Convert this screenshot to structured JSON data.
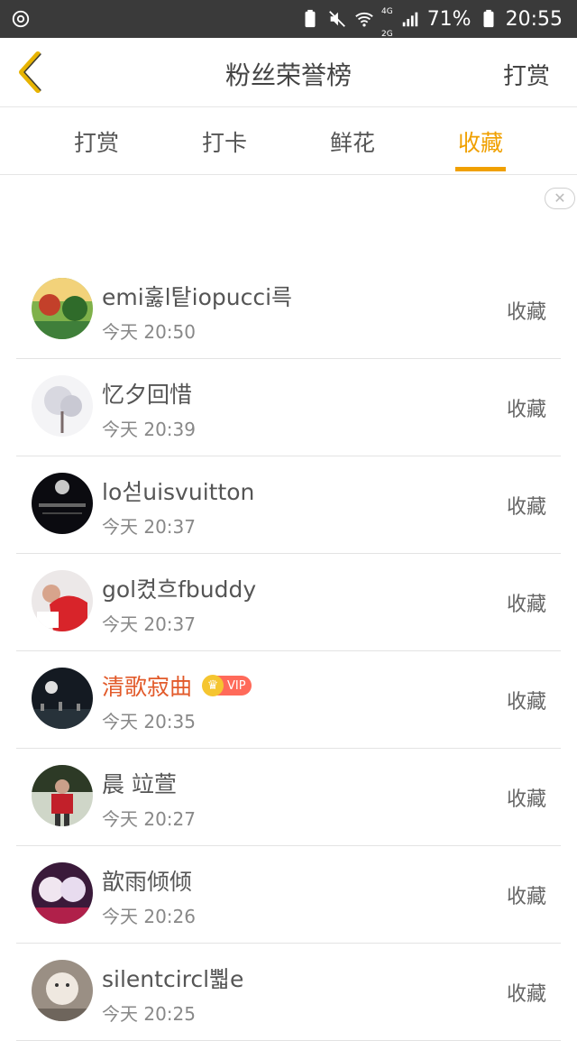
{
  "status_bar": {
    "battery": "71%",
    "time": "20:55",
    "net_top": "4G",
    "net_bottom": "2G",
    "icons": [
      "app-notification-icon",
      "battery-saver-icon",
      "mute-icon",
      "wifi-icon",
      "signal-icon",
      "battery-icon"
    ]
  },
  "header": {
    "title": "粉丝荣誉榜",
    "right_label": "打赏",
    "back_icon": "chevron-left-icon"
  },
  "tabs": [
    {
      "label": "打赏",
      "active": false
    },
    {
      "label": "打卡",
      "active": false
    },
    {
      "label": "鲜花",
      "active": false
    },
    {
      "label": "收藏",
      "active": true
    }
  ],
  "ad_close": "✕",
  "colors": {
    "accent": "#f0a000",
    "vip_name": "#e25a2a"
  },
  "list": [
    {
      "name": "emi훓l탙iopucci륵",
      "time": "今天 20:50",
      "action": "收藏",
      "vip": false
    },
    {
      "name": "忆夕回惜",
      "time": "今天 20:39",
      "action": "收藏",
      "vip": false
    },
    {
      "name": "lo섣uisvuitton",
      "time": "今天 20:37",
      "action": "收藏",
      "vip": false
    },
    {
      "name": "gol켰흐fbuddy",
      "time": "今天 20:37",
      "action": "收藏",
      "vip": false
    },
    {
      "name": "清歌寂曲",
      "time": "今天 20:35",
      "action": "收藏",
      "vip": true,
      "vip_label": "VIP"
    },
    {
      "name": "晨 竝萱",
      "time": "今天 20:27",
      "action": "收藏",
      "vip": false
    },
    {
      "name": "歆雨倾倾",
      "time": "今天 20:26",
      "action": "收藏",
      "vip": false
    },
    {
      "name": "silentcircl뿳e",
      "time": "今天 20:25",
      "action": "收藏",
      "vip": false
    }
  ]
}
